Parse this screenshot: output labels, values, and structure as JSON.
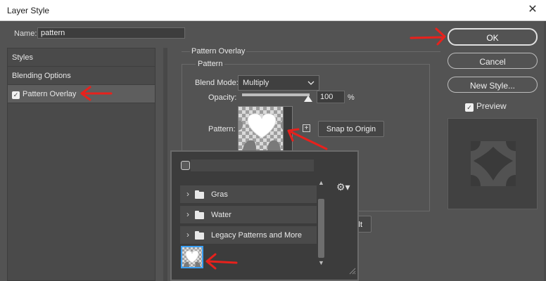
{
  "window": {
    "title": "Layer Style",
    "close_glyph": "✕"
  },
  "name_field": {
    "label": "Name:",
    "value": "pattern"
  },
  "left_panel": {
    "items": [
      {
        "label": "Styles",
        "selected": false
      },
      {
        "label": "Blending Options",
        "selected": false
      },
      {
        "label": "Pattern Overlay",
        "selected": true,
        "checked": true
      }
    ]
  },
  "pattern_overlay": {
    "group_title": "Pattern Overlay",
    "subgroup_title": "Pattern",
    "blend_mode_label": "Blend Mode:",
    "blend_mode_value": "Multiply",
    "opacity_label": "Opacity:",
    "opacity_value": "100",
    "opacity_unit": "%",
    "opacity_level": 1.0,
    "pattern_label": "Pattern:",
    "add_glyph": "+",
    "snap_label": "Snap to Origin",
    "hidden_button_label": "lt"
  },
  "pattern_picker": {
    "folders": [
      {
        "name": "Gras"
      },
      {
        "name": "Water"
      },
      {
        "name": "Legacy Patterns and More"
      }
    ],
    "gear_glyph": "⚙▾",
    "caret_glyph": "›",
    "scroll_up_glyph": "▲",
    "scroll_down_glyph": "▼"
  },
  "buttons": {
    "ok": "OK",
    "cancel": "Cancel",
    "new_style": "New Style..."
  },
  "preview": {
    "label": "Preview",
    "checked": true,
    "check_glyph": "✓"
  },
  "colors": {
    "dialog_bg": "#535353",
    "panel_bg": "#4a4a4a",
    "selection_blue": "#3ba0f5",
    "annotation_red": "#e8211c"
  },
  "icons": [
    "close-icon",
    "checkbox-icon",
    "chevron-down-icon",
    "slider-thumb-icon",
    "plus-icon",
    "search-icon",
    "gear-icon",
    "folder-icon",
    "caret-right-icon",
    "resize-grip-icon"
  ]
}
